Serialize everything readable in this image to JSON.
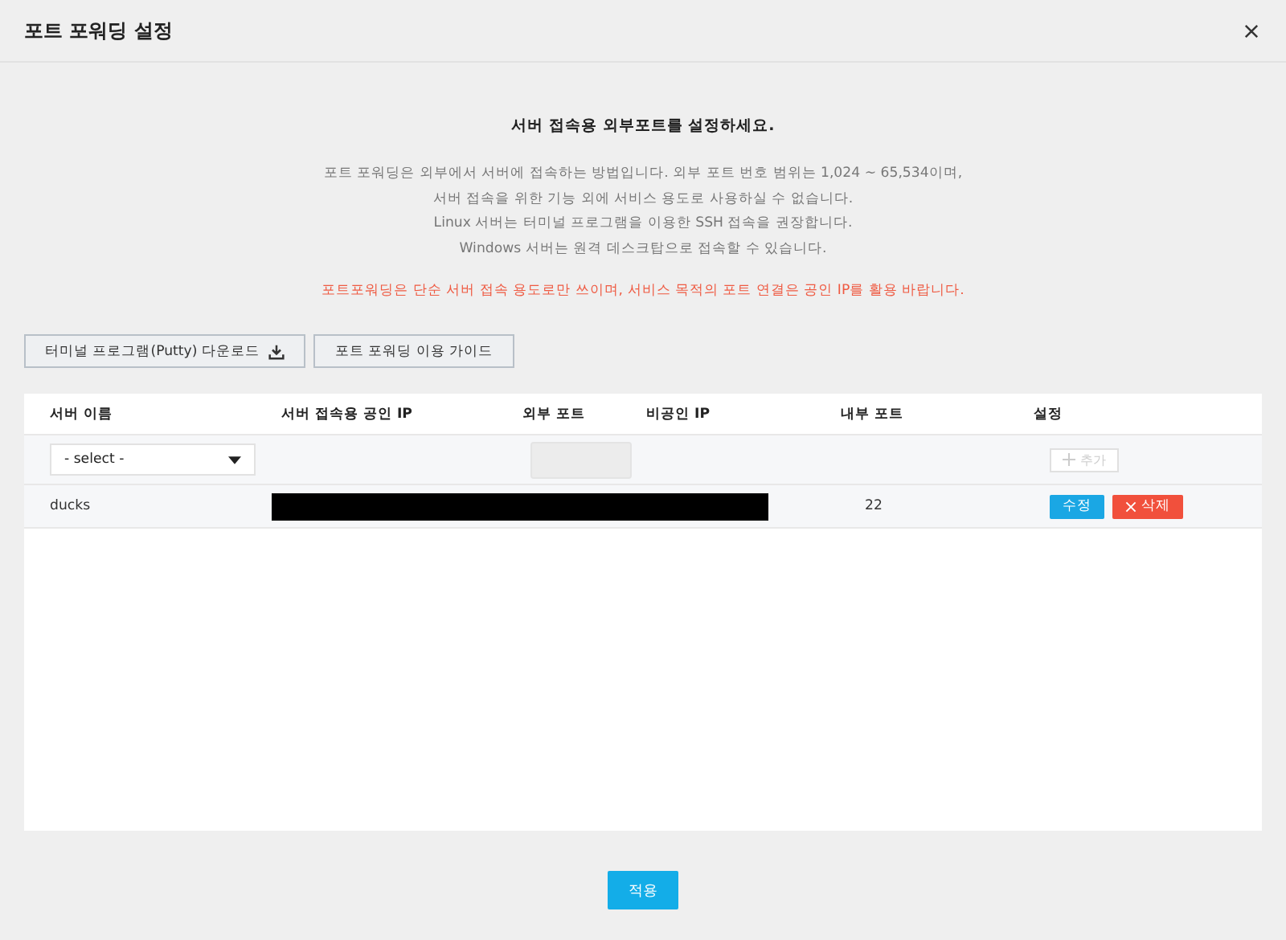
{
  "window": {
    "title": "포트 포워딩 설정"
  },
  "intro": {
    "heading": "서버 접속용 외부포트를 설정하세요.",
    "lines": [
      "포트 포워딩은 외부에서 서버에 접속하는 방법입니다. 외부 포트 번호 범위는 1,024 ~ 65,534이며,",
      "서버 접속을 위한 기능 외에 서비스 용도로 사용하실 수 없습니다.",
      "Linux 서버는 터미널 프로그램을 이용한 SSH 접속을 권장합니다.",
      "Windows 서버는 원격 데스크탑으로 접속할 수 있습니다."
    ],
    "warning": "포트포워딩은 단순 서버 접속 용도로만 쓰이며, 서비스 목적의 포트 연결은 공인 IP를 활용 바랍니다."
  },
  "toolbar": [
    {
      "label": "터미널 프로그램(Putty) 다운로드",
      "kind": "download"
    },
    {
      "label": "포트 포워딩 이용 가이드",
      "kind": "plain"
    }
  ],
  "table": {
    "columns": [
      "서버 이름",
      "서버 접속용 공인 IP",
      "외부 포트",
      "비공인 IP",
      "내부 포트",
      "설정"
    ],
    "new_row": {
      "select": "- select -",
      "add_label": "추가",
      "add_disabled": true
    },
    "rows": [
      {
        "name": "ducks",
        "redacted": true,
        "internal_port": "22",
        "edit": "수정",
        "delete": "삭제"
      }
    ]
  },
  "apply_button": "적용"
}
